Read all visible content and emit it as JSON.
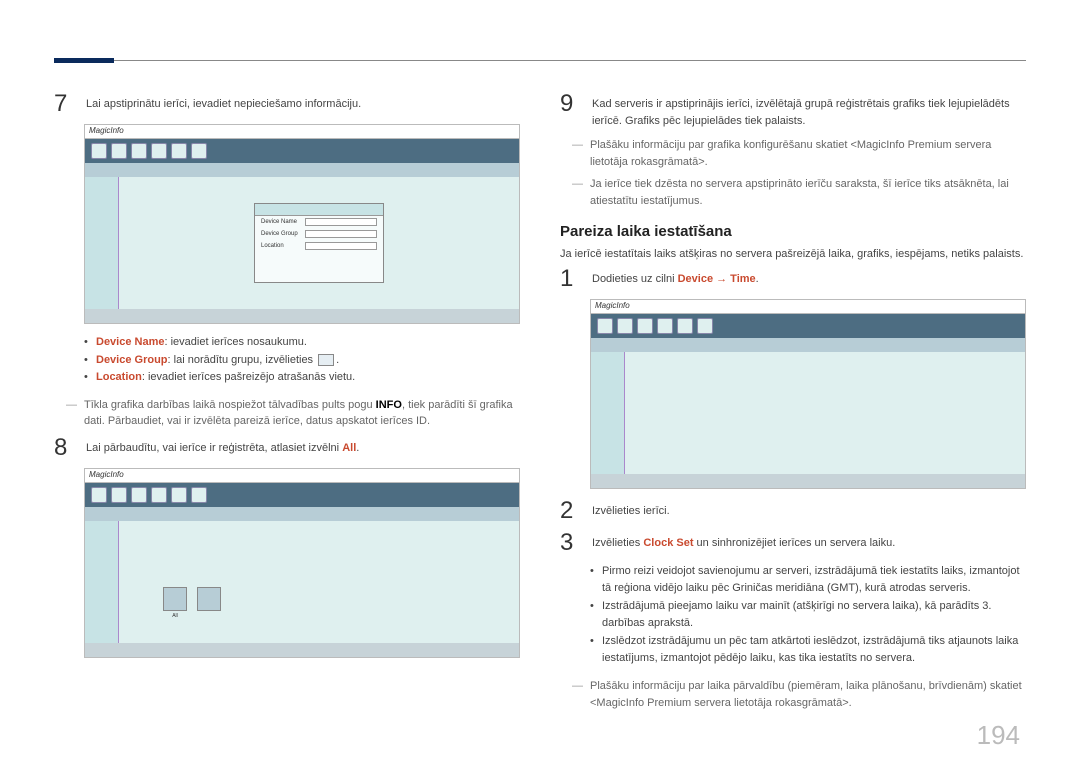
{
  "page_number": "194",
  "left": {
    "step7": "Lai apstiprinātu ierīci, ievadiet nepieciešamo informāciju.",
    "shot_logo": "MagicInfo",
    "dialog_labels": {
      "name": "Device Name",
      "group": "Device Group",
      "location": "Location"
    },
    "bullets": {
      "b1_label": "Device Name",
      "b1_text": ": ievadiet ierīces nosaukumu.",
      "b2_label": "Device Group",
      "b2_text": ": lai norādītu grupu, izvēlieties ",
      "b3_label": "Location",
      "b3_text": ": ievadiet ierīces pašreizējo atrašanās vietu."
    },
    "note7_pre": "Tīkla grafika darbības laikā nospiežot tālvadības pults pogu ",
    "note7_bold": "INFO",
    "note7_post": ", tiek parādīti šī grafika dati. Pārbaudiet, vai ir izvēlēta pareizā ierīce, datus apskatot ierīces ID.",
    "step8_pre": "Lai pārbaudītu, vai ierīce ir reģistrēta, atlasiet izvēlni ",
    "step8_hl": "All",
    "step8_post": ".",
    "biglabels": {
      "a": "All",
      "b": ""
    }
  },
  "right": {
    "step9": "Kad serveris ir apstiprinājis ierīci, izvēlētajā grupā reģistrētais grafiks tiek lejupielādēts ierīcē. Grafiks pēc lejupielādes tiek palaists.",
    "note9a": "Plašāku informāciju par grafika konfigurēšanu skatiet <MagicInfo Premium servera lietotāja rokasgrāmatā>.",
    "note9b": "Ja ierīce tiek dzēsta no servera apstiprināto ierīču saraksta, šī ierīce tiks atsāknēta, lai atiestatītu iestatījumus.",
    "h2": "Pareiza laika iestatīšana",
    "h2_sub": "Ja ierīcē iestatītais laiks atšķiras no servera pašreizējā laika, grafiks, iespējams, netiks palaists.",
    "step1_pre": "Dodieties uz cilni ",
    "step1_hl": "Device → Time",
    "step1_post": ".",
    "step2": "Izvēlieties ierīci.",
    "step3_pre1": "Izvēlieties ",
    "step3_hl": "Clock Set",
    "step3_pre2": " un sinhronizējiet ierīces un servera laiku.",
    "b_after": {
      "b1": "Pirmo reizi veidojot savienojumu ar serveri, izstrādājumā tiek iestatīts laiks, izmantojot tā reģiona vidējo laiku pēc Griničas meridiāna (GMT), kurā atrodas serveris.",
      "b2": "Izstrādājumā pieejamo laiku var mainīt (atšķirīgi no servera laika), kā parādīts 3. darbības aprakstā.",
      "b3": "Izslēdzot izstrādājumu un pēc tam atkārtoti ieslēdzot, izstrādājumā tiks atjaunots laika iestatījums, izmantojot pēdējo laiku, kas tika iestatīts no servera."
    },
    "note_last": "Plašāku informāciju par laika pārvaldību (piemēram, laika plānošanu, brīvdienām) skatiet <MagicInfo Premium servera lietotāja rokasgrāmatā>."
  }
}
